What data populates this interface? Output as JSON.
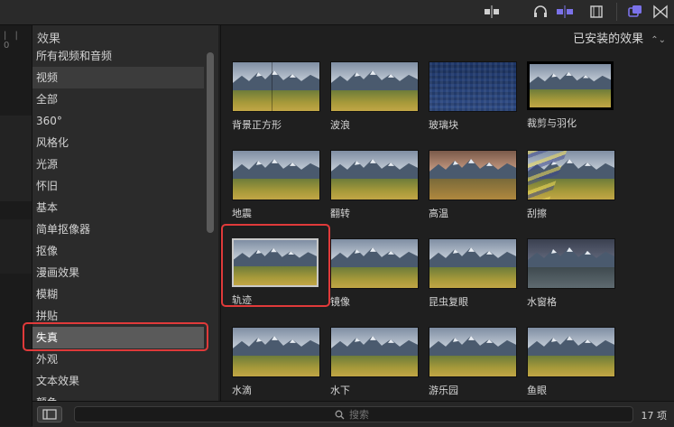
{
  "panel_title": "效果",
  "installed_filter": "已安装的效果",
  "categories": [
    "所有视频和音频",
    "视频",
    "全部",
    "360°",
    "风格化",
    "光源",
    "怀旧",
    "基本",
    "简单抠像器",
    "抠像",
    "漫画效果",
    "模糊",
    "拼贴",
    "失真",
    "外观",
    "文本效果",
    "颜色"
  ],
  "selected_category": "失真",
  "effects": [
    {
      "label": "背景正方形",
      "style": "split"
    },
    {
      "label": "波浪",
      "style": "normal"
    },
    {
      "label": "玻璃块",
      "style": "blue"
    },
    {
      "label": "裁剪与羽化",
      "style": "crop"
    },
    {
      "label": "地震",
      "style": "normal"
    },
    {
      "label": "翻转",
      "style": "normal"
    },
    {
      "label": "高温",
      "style": "warm"
    },
    {
      "label": "刮擦",
      "style": "streak"
    },
    {
      "label": "轨迹",
      "style": "selected"
    },
    {
      "label": "镜像",
      "style": "normal"
    },
    {
      "label": "昆虫复眼",
      "style": "normal"
    },
    {
      "label": "水窗格",
      "style": "night"
    },
    {
      "label": "水滴",
      "style": "normal"
    },
    {
      "label": "水下",
      "style": "normal"
    },
    {
      "label": "游乐园",
      "style": "normal"
    },
    {
      "label": "鱼眼",
      "style": "normal"
    }
  ],
  "selected_effect": "轨迹",
  "search": {
    "placeholder": "搜索",
    "value": ""
  },
  "item_count": "17 项",
  "left_strip_ticks": "|  |  0",
  "colors": {
    "accent": "#7b72e9",
    "highlight": "#e03a3a"
  }
}
